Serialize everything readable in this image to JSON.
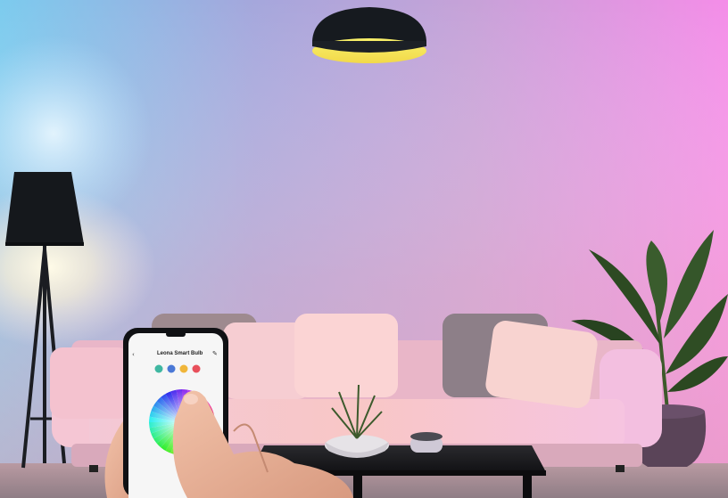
{
  "phone_app": {
    "title": "Leona Smart Bulb",
    "back_glyph": "‹",
    "edit_glyph": "✎",
    "preset_colors": [
      "#3fb7a1",
      "#4a78d6",
      "#f0b63a",
      "#e8505b"
    ],
    "icons": [
      "back-arrow-icon",
      "edit-icon",
      "color-wheel-icon"
    ]
  },
  "scene": {
    "wall_gradient": [
      "#6fc8ee",
      "#9aa6dd",
      "#c9a0d8",
      "#f08ee8"
    ],
    "lamp_glow": "#fff6dc",
    "pendant_light": "#f6e86a"
  }
}
